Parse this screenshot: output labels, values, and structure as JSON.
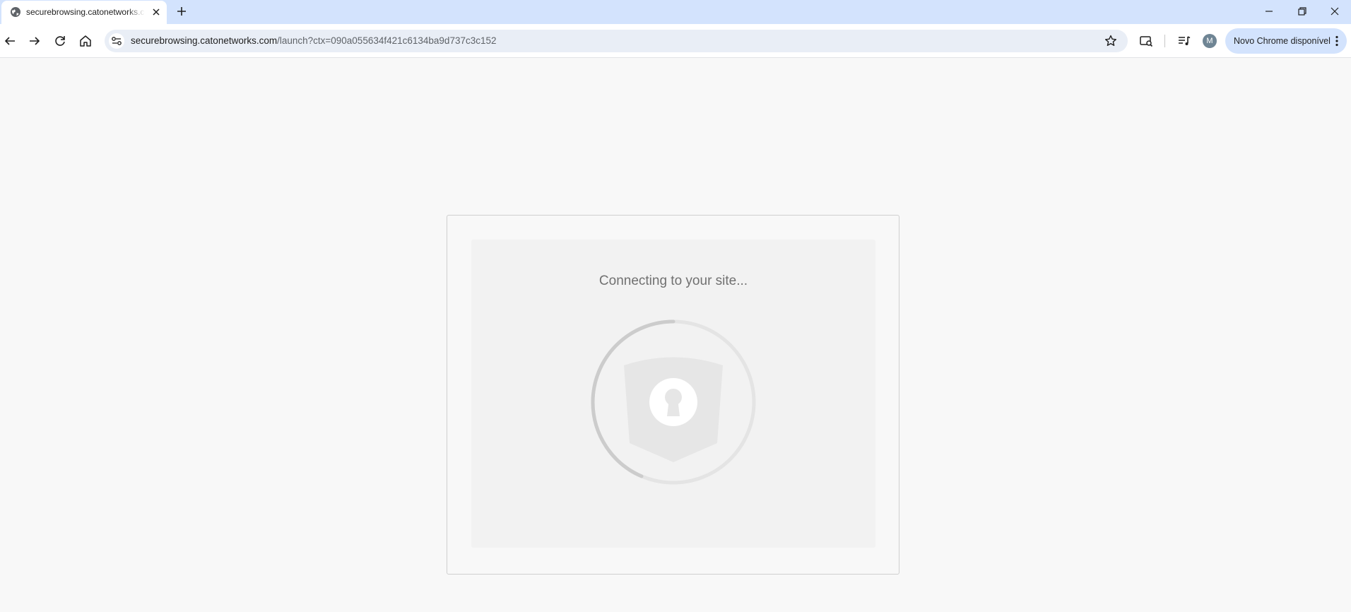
{
  "browser": {
    "tab": {
      "title": "securebrowsing.catonetworks.com",
      "favicon": "globe-icon"
    },
    "window_controls": [
      "minimize-icon",
      "restore-icon",
      "close-icon"
    ],
    "address_bar": {
      "host": "securebrowsing.catonetworks.com",
      "path": "/launch?ctx=090a055634f421c6134ba9d737c3c152"
    },
    "profile_initial": "M",
    "update_chip": "Novo Chrome disponível"
  },
  "page": {
    "status_text": "Connecting to your site...",
    "spinner_icon": "shield-lock-icon"
  },
  "colors": {
    "tabstrip": "#d3e3fd",
    "omnibox": "#e9eef6",
    "page_bg": "#f8f8f8",
    "card_inner": "#f2f2f2",
    "status_text": "#707070"
  }
}
